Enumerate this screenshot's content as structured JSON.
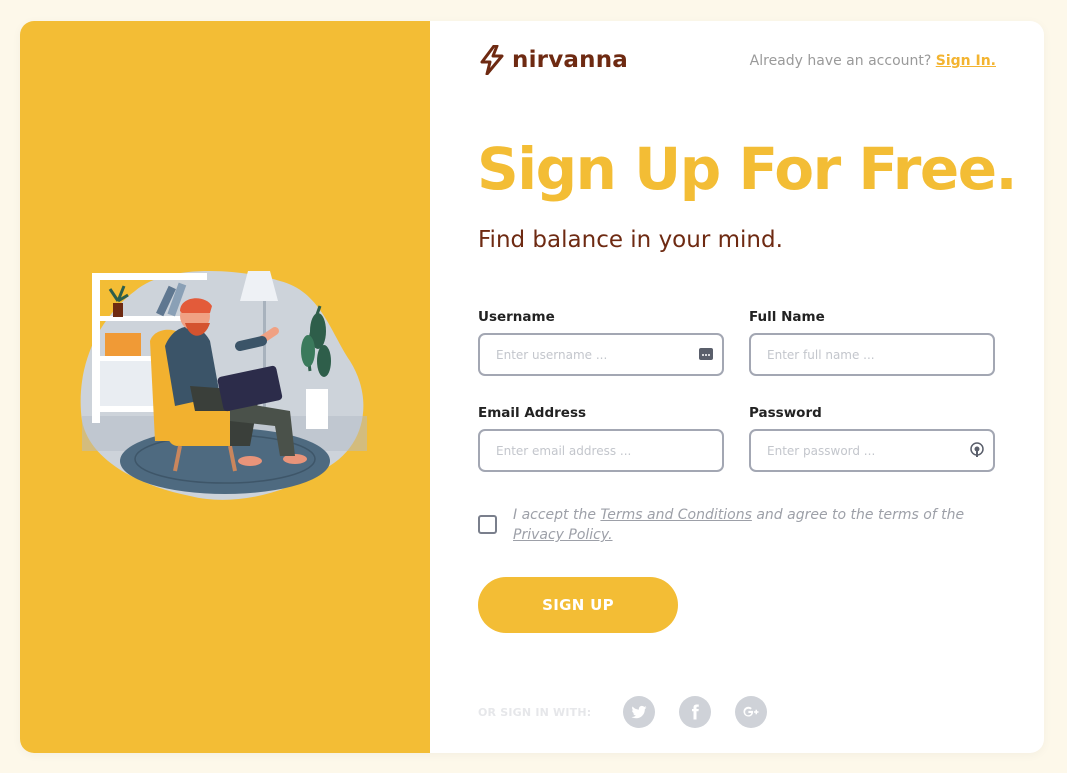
{
  "brand": {
    "name": "nirvanna",
    "brand_color": "#6e2a12",
    "accent_color": "#f3bd35"
  },
  "header": {
    "account_prompt": "Already have an account?",
    "sign_in_label": "Sign In."
  },
  "main": {
    "headline": "Sign Up For Free.",
    "subheadline": "Find balance in your mind."
  },
  "form": {
    "username": {
      "label": "Username",
      "placeholder": "Enter username ...",
      "value": ""
    },
    "full_name": {
      "label": "Full Name",
      "placeholder": "Enter full name ...",
      "value": ""
    },
    "email": {
      "label": "Email Address",
      "placeholder": "Enter email address ...",
      "value": ""
    },
    "password": {
      "label": "Password",
      "placeholder": "Enter password ...",
      "value": ""
    },
    "terms": {
      "checked": false,
      "prefix": "I accept the",
      "terms_link": "Terms and Conditions",
      "middle": "and agree to the terms of the",
      "privacy_link": "Privacy Policy."
    },
    "submit_label": "SIGN UP"
  },
  "social": {
    "label": "OR SIGN IN WITH:",
    "providers": [
      "twitter-icon",
      "facebook-icon",
      "google-plus-icon"
    ]
  },
  "icons": {
    "logo": "lightning-bolt-icon",
    "username_field": "keyboard-dots-icon",
    "password_field": "fingerprint-key-icon"
  }
}
